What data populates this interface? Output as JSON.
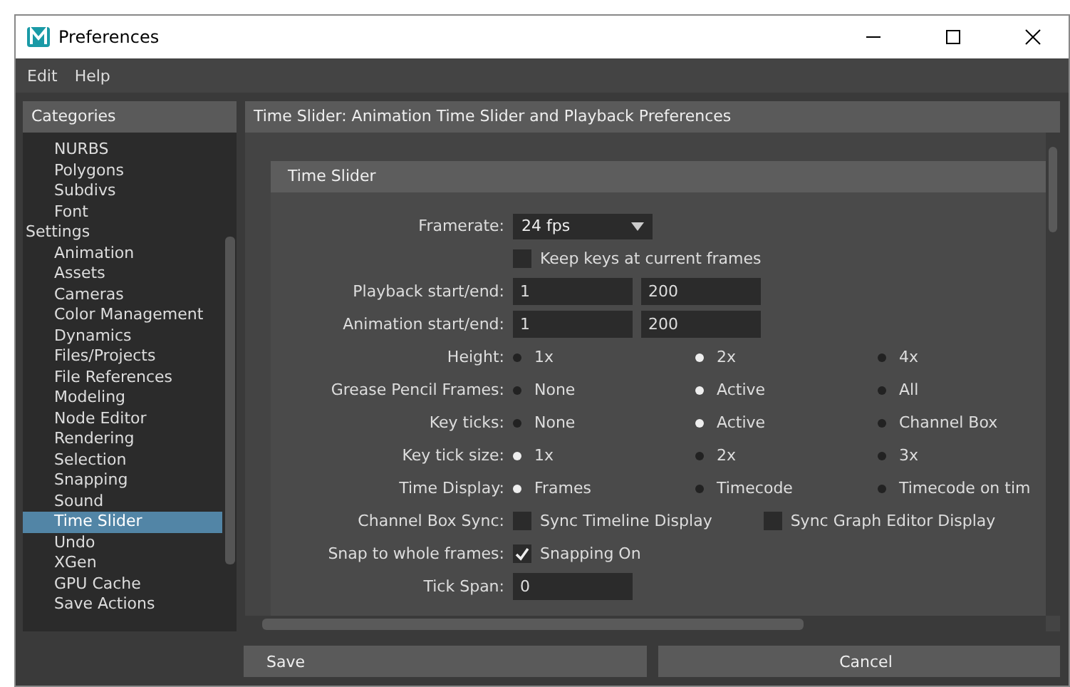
{
  "window": {
    "title": "Preferences"
  },
  "menu": [
    "Edit",
    "Help"
  ],
  "categories": {
    "title": "Categories",
    "items": [
      {
        "children": [
          {
            "label": "NURBS",
            "selected": false
          },
          {
            "label": "Polygons",
            "selected": false
          },
          {
            "label": "Subdivs",
            "selected": false
          },
          {
            "label": "Font",
            "selected": false
          }
        ]
      },
      {
        "label": "Settings",
        "selected": false,
        "children": [
          {
            "label": "Animation",
            "selected": false
          },
          {
            "label": "Assets",
            "selected": false
          },
          {
            "label": "Cameras",
            "selected": false
          },
          {
            "label": "Color Management",
            "selected": false
          },
          {
            "label": "Dynamics",
            "selected": false
          },
          {
            "label": "Files/Projects",
            "selected": false
          },
          {
            "label": "File References",
            "selected": false
          },
          {
            "label": "Modeling",
            "selected": false
          },
          {
            "label": "Node Editor",
            "selected": false
          },
          {
            "label": "Rendering",
            "selected": false
          },
          {
            "label": "Selection",
            "selected": false
          },
          {
            "label": "Snapping",
            "selected": false
          },
          {
            "label": "Sound",
            "selected": false
          },
          {
            "label": "Time Slider",
            "selected": true
          },
          {
            "label": "Undo",
            "selected": false
          },
          {
            "label": "XGen",
            "selected": false
          },
          {
            "label": "GPU Cache",
            "selected": false
          },
          {
            "label": "Save Actions",
            "selected": false
          }
        ]
      }
    ]
  },
  "panel": {
    "title": "Time Slider: Animation Time Slider and Playback Preferences",
    "section": "Time Slider",
    "rows": [
      {
        "kind": "dropdown",
        "label": "Framerate:",
        "value": "24 fps"
      },
      {
        "kind": "checks",
        "options": [
          {
            "label": "Keep keys at current frames",
            "checked": false
          }
        ]
      },
      {
        "kind": "fields",
        "label": "Playback start/end:",
        "values": [
          "1",
          "200"
        ]
      },
      {
        "kind": "fields",
        "label": "Animation start/end:",
        "values": [
          "1",
          "200"
        ]
      },
      {
        "kind": "radio",
        "label": "Height:",
        "options": [
          {
            "label": "1x",
            "selected": false
          },
          {
            "label": "2x",
            "selected": true
          },
          {
            "label": "4x",
            "selected": false
          }
        ]
      },
      {
        "kind": "radio",
        "label": "Grease Pencil Frames:",
        "options": [
          {
            "label": "None",
            "selected": false
          },
          {
            "label": "Active",
            "selected": true
          },
          {
            "label": "All",
            "selected": false
          }
        ]
      },
      {
        "kind": "radio",
        "label": "Key ticks:",
        "options": [
          {
            "label": "None",
            "selected": false
          },
          {
            "label": "Active",
            "selected": true
          },
          {
            "label": "Channel Box",
            "selected": false
          }
        ]
      },
      {
        "kind": "radio",
        "label": "Key tick size:",
        "options": [
          {
            "label": "1x",
            "selected": true
          },
          {
            "label": "2x",
            "selected": false
          },
          {
            "label": "3x",
            "selected": false
          }
        ]
      },
      {
        "kind": "radio",
        "label": "Time Display:",
        "options": [
          {
            "label": "Frames",
            "selected": true
          },
          {
            "label": "Timecode",
            "selected": false
          },
          {
            "label": "Timecode on tim",
            "selected": false
          }
        ]
      },
      {
        "kind": "checks",
        "label": "Channel Box Sync:",
        "options": [
          {
            "label": "Sync Timeline Display",
            "checked": false
          },
          {
            "label": "Sync Graph Editor Display",
            "checked": false
          }
        ]
      },
      {
        "kind": "checks",
        "label": "Snap to whole frames:",
        "options": [
          {
            "label": "Snapping On",
            "checked": true
          }
        ]
      },
      {
        "kind": "field",
        "label": "Tick Span:",
        "value": "0"
      }
    ]
  },
  "buttons": [
    "Save",
    "Cancel"
  ]
}
